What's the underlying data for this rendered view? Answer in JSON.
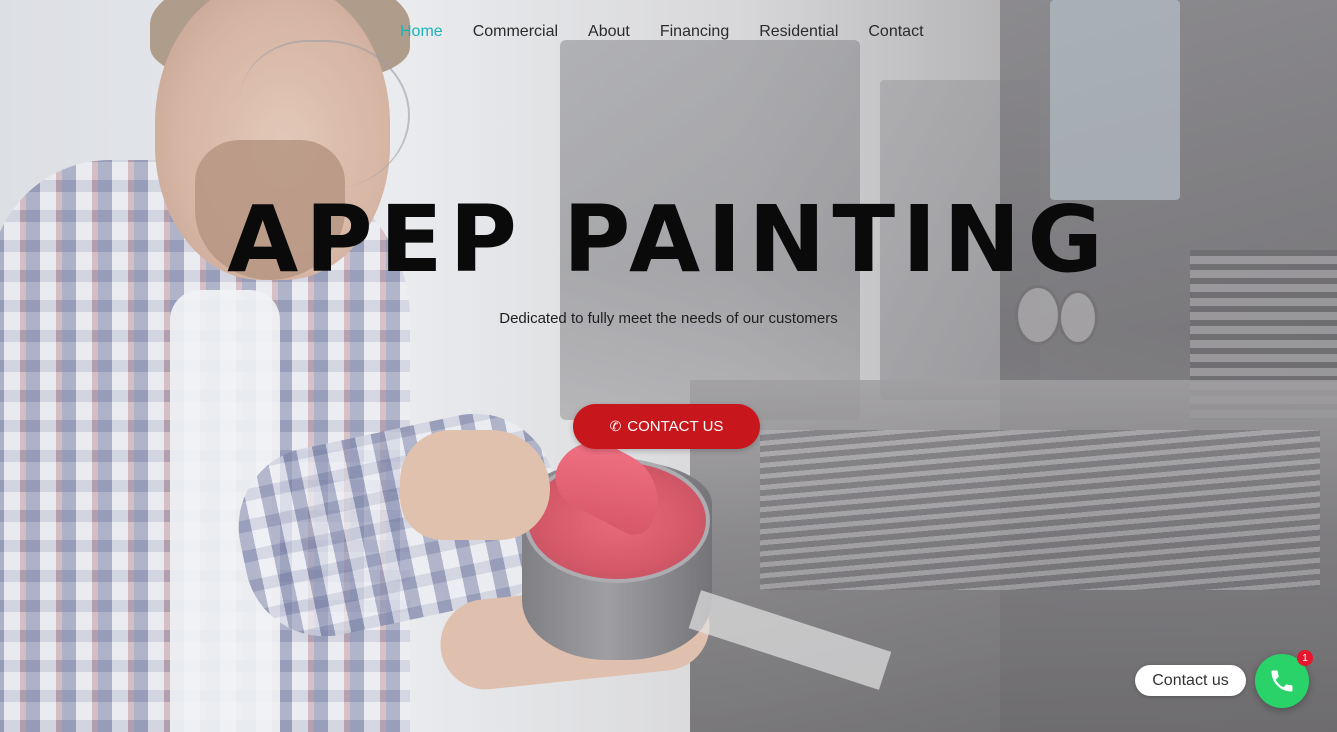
{
  "nav": {
    "items": [
      {
        "label": "Home",
        "active": true
      },
      {
        "label": "Commercial",
        "active": false
      },
      {
        "label": "About",
        "active": false
      },
      {
        "label": "Financing",
        "active": false
      },
      {
        "label": "Residential",
        "active": false
      },
      {
        "label": "Contact",
        "active": false
      }
    ]
  },
  "hero": {
    "title": "APEP PAINTING",
    "subtitle": "Dedicated to fully meet the needs of our customers",
    "cta_label": "CONTACT US",
    "cta_icon": "phone-icon"
  },
  "contact_widget": {
    "label": "Contact us",
    "badge_count": "1",
    "icon": "phone-icon"
  },
  "colors": {
    "nav_active": "#1db2b8",
    "cta_background": "#c8171c",
    "fab_background": "#2ad26a",
    "badge_background": "#e6162d"
  }
}
